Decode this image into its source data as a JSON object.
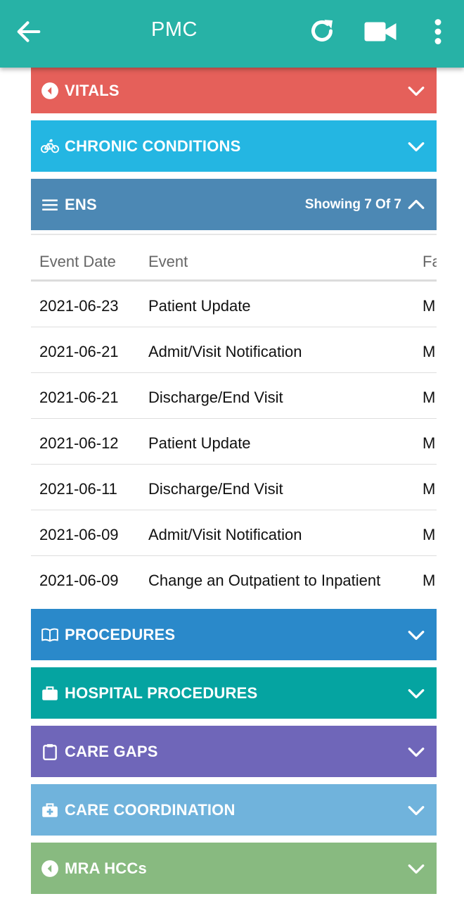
{
  "appbar": {
    "title": "PMC",
    "back_icon": "arrow-left-icon",
    "refresh_icon": "refresh-icon",
    "video_icon": "video-camera-icon",
    "more_icon": "more-vertical-icon",
    "color": "#27b2a6"
  },
  "sections": {
    "vitals": {
      "label": "VITALS",
      "icon": "circle-chevron-left-icon",
      "color": "#e5605a"
    },
    "chronic": {
      "label": "CHRONIC CONDITIONS",
      "icon": "bicycle-icon",
      "color": "#24b6e2"
    },
    "ens": {
      "label": "ENS",
      "icon": "menu-lines-icon",
      "count": "Showing 7 Of 7",
      "color": "#4c88b4"
    },
    "procedures": {
      "label": "PROCEDURES",
      "icon": "book-icon",
      "color": "#2a89ca"
    },
    "hospital": {
      "label": "HOSPITAL PROCEDURES",
      "icon": "briefcase-icon",
      "color": "#05a4a1"
    },
    "caregaps": {
      "label": "CARE GAPS",
      "icon": "clipboard-icon",
      "color": "#6f66b9"
    },
    "carecoord": {
      "label": "CARE COORDINATION",
      "icon": "medical-kit-icon",
      "color": "#70b3dc"
    },
    "mra": {
      "label": "MRA HCCs",
      "icon": "circle-chevron-left-icon",
      "color": "#88ba80"
    }
  },
  "ens_table": {
    "columns": [
      "Event Date",
      "Event",
      "Fa"
    ],
    "rows": [
      {
        "date": "2021-06-23",
        "event": "Patient Update",
        "fac": "M"
      },
      {
        "date": "2021-06-21",
        "event": "Admit/Visit Notification",
        "fac": "M"
      },
      {
        "date": "2021-06-21",
        "event": "Discharge/End Visit",
        "fac": "M"
      },
      {
        "date": "2021-06-12",
        "event": "Patient Update",
        "fac": "M"
      },
      {
        "date": "2021-06-11",
        "event": "Discharge/End Visit",
        "fac": "M"
      },
      {
        "date": "2021-06-09",
        "event": "Admit/Visit Notification",
        "fac": "M"
      },
      {
        "date": "2021-06-09",
        "event": "Change an Outpatient to Inpatient",
        "fac": "M"
      }
    ]
  }
}
